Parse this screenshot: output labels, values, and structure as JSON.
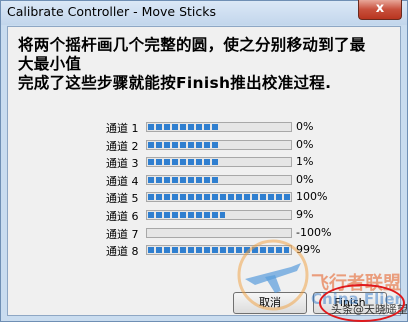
{
  "window": {
    "title": "Calibrate Controller - Move Sticks",
    "close_glyph": "x"
  },
  "instructions": {
    "line1": "将两个摇杆画几个完整的圆，使之分别移动到了最",
    "line2": "大最小值",
    "line3": "完成了这些步骤就能按Finish推出校准过程."
  },
  "channels": [
    {
      "label": "通道 1",
      "percent_text": "0%",
      "fill": 0.49
    },
    {
      "label": "通道 2",
      "percent_text": "0%",
      "fill": 0.49
    },
    {
      "label": "通道 3",
      "percent_text": "1%",
      "fill": 0.5
    },
    {
      "label": "通道 4",
      "percent_text": "0%",
      "fill": 0.49
    },
    {
      "label": "通道 5",
      "percent_text": "100%",
      "fill": 1.0
    },
    {
      "label": "通道 6",
      "percent_text": "9%",
      "fill": 0.54
    },
    {
      "label": "通道 7",
      "percent_text": "-100%",
      "fill": 0.0
    },
    {
      "label": "通道 8",
      "percent_text": "99%",
      "fill": 0.99
    }
  ],
  "buttons": {
    "cancel": "取消",
    "finish": "Finish"
  },
  "watermark": {
    "logo_text": "飞行者联盟",
    "logo_sub": "China Flier",
    "credit": "头条@天晓遥望"
  },
  "colors": {
    "bar_fill": "#2f7fd0",
    "highlight_circle": "#e0191c"
  }
}
